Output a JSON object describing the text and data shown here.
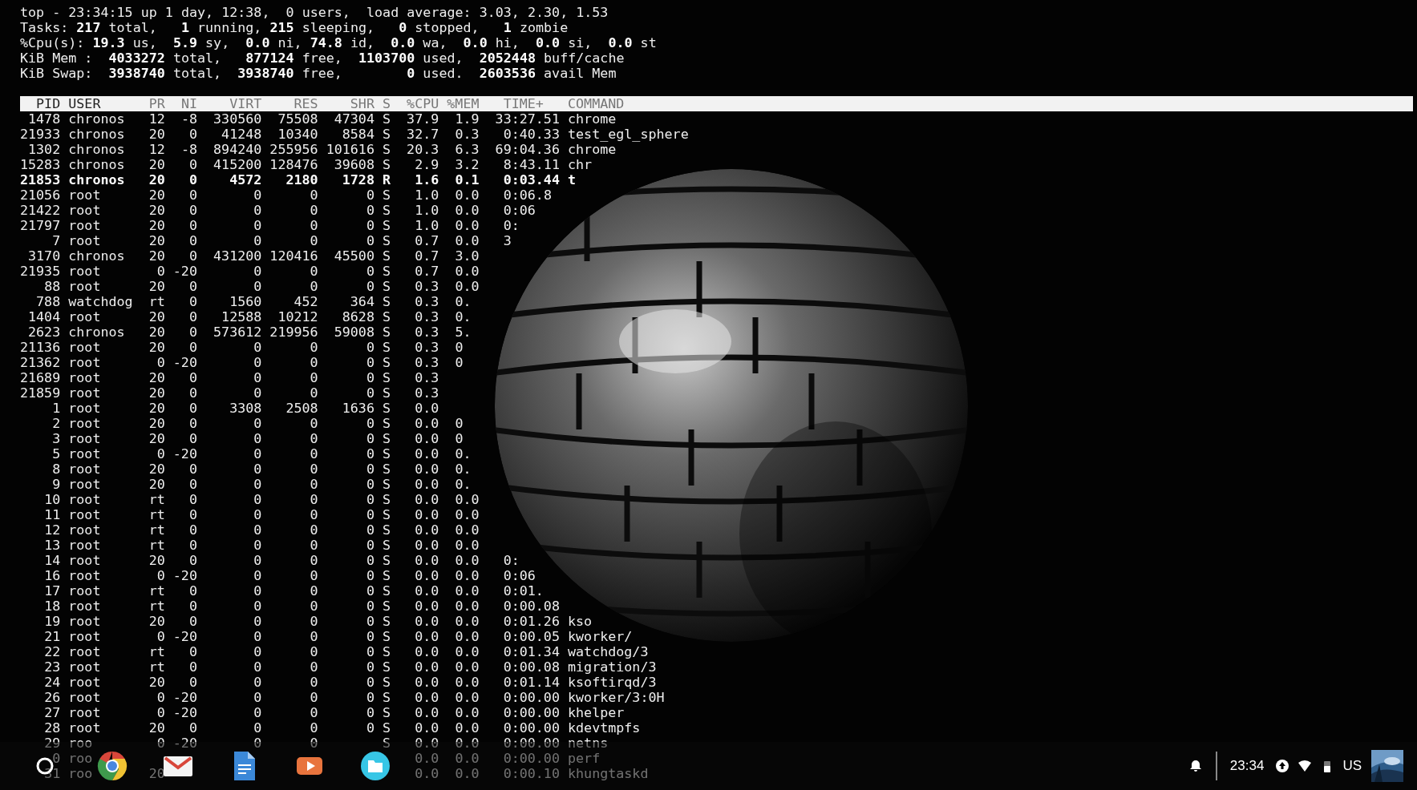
{
  "terminal": {
    "summary": [
      "top - 23:34:15 up 1 day, 12:38,  0 users,  load average: 3.03, 2.30, 1.53",
      "Tasks: **217** total,   **1** running, **215** sleeping,   **0** stopped,   **1** zombie",
      "%Cpu(s): **19.3** us,  **5.9** sy,  **0.0** ni, **74.8** id,  **0.0** wa,  **0.0** hi,  **0.0** si,  **0.0** st",
      "KiB Mem :  **4033272** total,   **877124** free,  **1103700** used,  **2052448** buff/cache",
      "KiB Swap:  **3938740** total,  **3938740** free,        **0** used.  **2603536** avail Mem"
    ],
    "columns": [
      "PID",
      "USER",
      "PR",
      "NI",
      "VIRT",
      "RES",
      "SHR",
      "S",
      "%CPU",
      "%MEM",
      "TIME+",
      "COMMAND"
    ],
    "rows": [
      {
        "bold": false,
        "cells": {
          "pid": "1478",
          "user": "chronos",
          "pr": "12",
          "ni": "-8",
          "virt": "330560",
          "res": "75508",
          "shr": "47304",
          "s": "S",
          "cpu": "37.9",
          "mem": "1.9",
          "time": "33:27.51",
          "command": "chrome"
        }
      },
      {
        "bold": false,
        "cells": {
          "pid": "21933",
          "user": "chronos",
          "pr": "20",
          "ni": "0",
          "virt": "41248",
          "res": "10340",
          "shr": "8584",
          "s": "S",
          "cpu": "32.7",
          "mem": "0.3",
          "time": "0:40.33",
          "command": "test_egl_sphere"
        }
      },
      {
        "bold": false,
        "cells": {
          "pid": "1302",
          "user": "chronos",
          "pr": "12",
          "ni": "-8",
          "virt": "894240",
          "res": "255956",
          "shr": "101616",
          "s": "S",
          "cpu": "20.3",
          "mem": "6.3",
          "time": "69:04.36",
          "command": "chrome"
        }
      },
      {
        "bold": false,
        "cells": {
          "pid": "15283",
          "user": "chronos",
          "pr": "20",
          "ni": "0",
          "virt": "415200",
          "res": "128476",
          "shr": "39608",
          "s": "S",
          "cpu": "2.9",
          "mem": "3.2",
          "time": "8:43.11",
          "command": "chr"
        }
      },
      {
        "bold": true,
        "cells": {
          "pid": "21853",
          "user": "chronos",
          "pr": "20",
          "ni": "0",
          "virt": "4572",
          "res": "2180",
          "shr": "1728",
          "s": "R",
          "cpu": "1.6",
          "mem": "0.1",
          "time": "0:03.44",
          "command": "t"
        }
      },
      {
        "bold": false,
        "cells": {
          "pid": "21056",
          "user": "root",
          "pr": "20",
          "ni": "0",
          "virt": "0",
          "res": "0",
          "shr": "0",
          "s": "S",
          "cpu": "1.0",
          "mem": "0.0",
          "time": "0:06.8"
        }
      },
      {
        "bold": false,
        "cells": {
          "pid": "21422",
          "user": "root",
          "pr": "20",
          "ni": "0",
          "virt": "0",
          "res": "0",
          "shr": "0",
          "s": "S",
          "cpu": "1.0",
          "mem": "0.0",
          "time": "0:06"
        }
      },
      {
        "bold": false,
        "cells": {
          "pid": "21797",
          "user": "root",
          "pr": "20",
          "ni": "0",
          "virt": "0",
          "res": "0",
          "shr": "0",
          "s": "S",
          "cpu": "1.0",
          "mem": "0.0",
          "time": "0:"
        }
      },
      {
        "bold": false,
        "cells": {
          "pid": "7",
          "user": "root",
          "pr": "20",
          "ni": "0",
          "virt": "0",
          "res": "0",
          "shr": "0",
          "s": "S",
          "cpu": "0.7",
          "mem": "0.0",
          "time": "3"
        }
      },
      {
        "bold": false,
        "cells": {
          "pid": "3170",
          "user": "chronos",
          "pr": "20",
          "ni": "0",
          "virt": "431200",
          "res": "120416",
          "shr": "45500",
          "s": "S",
          "cpu": "0.7",
          "mem": "3.0"
        }
      },
      {
        "bold": false,
        "cells": {
          "pid": "21935",
          "user": "root",
          "pr": "0",
          "ni": "-20",
          "virt": "0",
          "res": "0",
          "shr": "0",
          "s": "S",
          "cpu": "0.7",
          "mem": "0.0"
        }
      },
      {
        "bold": false,
        "cells": {
          "pid": "88",
          "user": "root",
          "pr": "20",
          "ni": "0",
          "virt": "0",
          "res": "0",
          "shr": "0",
          "s": "S",
          "cpu": "0.3",
          "mem": "0.0"
        }
      },
      {
        "bold": false,
        "cells": {
          "pid": "788",
          "user": "watchdog",
          "pr": "rt",
          "ni": "0",
          "virt": "1560",
          "res": "452",
          "shr": "364",
          "s": "S",
          "cpu": "0.3",
          "mem": "0."
        }
      },
      {
        "bold": false,
        "cells": {
          "pid": "1404",
          "user": "root",
          "pr": "20",
          "ni": "0",
          "virt": "12588",
          "res": "10212",
          "shr": "8628",
          "s": "S",
          "cpu": "0.3",
          "mem": "0."
        }
      },
      {
        "bold": false,
        "cells": {
          "pid": "2623",
          "user": "chronos",
          "pr": "20",
          "ni": "0",
          "virt": "573612",
          "res": "219956",
          "shr": "59008",
          "s": "S",
          "cpu": "0.3",
          "mem": "5."
        }
      },
      {
        "bold": false,
        "cells": {
          "pid": "21136",
          "user": "root",
          "pr": "20",
          "ni": "0",
          "virt": "0",
          "res": "0",
          "shr": "0",
          "s": "S",
          "cpu": "0.3",
          "mem": "0"
        }
      },
      {
        "bold": false,
        "cells": {
          "pid": "21362",
          "user": "root",
          "pr": "0",
          "ni": "-20",
          "virt": "0",
          "res": "0",
          "shr": "0",
          "s": "S",
          "cpu": "0.3",
          "mem": "0"
        }
      },
      {
        "bold": false,
        "cells": {
          "pid": "21689",
          "user": "root",
          "pr": "20",
          "ni": "0",
          "virt": "0",
          "res": "0",
          "shr": "0",
          "s": "S",
          "cpu": "0.3"
        }
      },
      {
        "bold": false,
        "cells": {
          "pid": "21859",
          "user": "root",
          "pr": "20",
          "ni": "0",
          "virt": "0",
          "res": "0",
          "shr": "0",
          "s": "S",
          "cpu": "0.3"
        }
      },
      {
        "bold": false,
        "cells": {
          "pid": "1",
          "user": "root",
          "pr": "20",
          "ni": "0",
          "virt": "3308",
          "res": "2508",
          "shr": "1636",
          "s": "S",
          "cpu": "0.0"
        }
      },
      {
        "bold": false,
        "cells": {
          "pid": "2",
          "user": "root",
          "pr": "20",
          "ni": "0",
          "virt": "0",
          "res": "0",
          "shr": "0",
          "s": "S",
          "cpu": "0.0",
          "mem": "0"
        }
      },
      {
        "bold": false,
        "cells": {
          "pid": "3",
          "user": "root",
          "pr": "20",
          "ni": "0",
          "virt": "0",
          "res": "0",
          "shr": "0",
          "s": "S",
          "cpu": "0.0",
          "mem": "0"
        }
      },
      {
        "bold": false,
        "cells": {
          "pid": "5",
          "user": "root",
          "pr": "0",
          "ni": "-20",
          "virt": "0",
          "res": "0",
          "shr": "0",
          "s": "S",
          "cpu": "0.0",
          "mem": "0."
        }
      },
      {
        "bold": false,
        "cells": {
          "pid": "8",
          "user": "root",
          "pr": "20",
          "ni": "0",
          "virt": "0",
          "res": "0",
          "shr": "0",
          "s": "S",
          "cpu": "0.0",
          "mem": "0."
        }
      },
      {
        "bold": false,
        "cells": {
          "pid": "9",
          "user": "root",
          "pr": "20",
          "ni": "0",
          "virt": "0",
          "res": "0",
          "shr": "0",
          "s": "S",
          "cpu": "0.0",
          "mem": "0."
        }
      },
      {
        "bold": false,
        "cells": {
          "pid": "10",
          "user": "root",
          "pr": "rt",
          "ni": "0",
          "virt": "0",
          "res": "0",
          "shr": "0",
          "s": "S",
          "cpu": "0.0",
          "mem": "0.0"
        }
      },
      {
        "bold": false,
        "cells": {
          "pid": "11",
          "user": "root",
          "pr": "rt",
          "ni": "0",
          "virt": "0",
          "res": "0",
          "shr": "0",
          "s": "S",
          "cpu": "0.0",
          "mem": "0.0"
        }
      },
      {
        "bold": false,
        "cells": {
          "pid": "12",
          "user": "root",
          "pr": "rt",
          "ni": "0",
          "virt": "0",
          "res": "0",
          "shr": "0",
          "s": "S",
          "cpu": "0.0",
          "mem": "0.0"
        }
      },
      {
        "bold": false,
        "cells": {
          "pid": "13",
          "user": "root",
          "pr": "rt",
          "ni": "0",
          "virt": "0",
          "res": "0",
          "shr": "0",
          "s": "S",
          "cpu": "0.0",
          "mem": "0.0"
        }
      },
      {
        "bold": false,
        "cells": {
          "pid": "14",
          "user": "root",
          "pr": "20",
          "ni": "0",
          "virt": "0",
          "res": "0",
          "shr": "0",
          "s": "S",
          "cpu": "0.0",
          "mem": "0.0",
          "time": "0:"
        }
      },
      {
        "bold": false,
        "cells": {
          "pid": "16",
          "user": "root",
          "pr": "0",
          "ni": "-20",
          "virt": "0",
          "res": "0",
          "shr": "0",
          "s": "S",
          "cpu": "0.0",
          "mem": "0.0",
          "time": "0:06"
        }
      },
      {
        "bold": false,
        "cells": {
          "pid": "17",
          "user": "root",
          "pr": "rt",
          "ni": "0",
          "virt": "0",
          "res": "0",
          "shr": "0",
          "s": "S",
          "cpu": "0.0",
          "mem": "0.0",
          "time": "0:01."
        }
      },
      {
        "bold": false,
        "cells": {
          "pid": "18",
          "user": "root",
          "pr": "rt",
          "ni": "0",
          "virt": "0",
          "res": "0",
          "shr": "0",
          "s": "S",
          "cpu": "0.0",
          "mem": "0.0",
          "time": "0:00.08"
        }
      },
      {
        "bold": false,
        "cells": {
          "pid": "19",
          "user": "root",
          "pr": "20",
          "ni": "0",
          "virt": "0",
          "res": "0",
          "shr": "0",
          "s": "S",
          "cpu": "0.0",
          "mem": "0.0",
          "time": "0:01.26",
          "command": "kso"
        }
      },
      {
        "bold": false,
        "cells": {
          "pid": "21",
          "user": "root",
          "pr": "0",
          "ni": "-20",
          "virt": "0",
          "res": "0",
          "shr": "0",
          "s": "S",
          "cpu": "0.0",
          "mem": "0.0",
          "time": "0:00.05",
          "command": "kworker/"
        }
      },
      {
        "bold": false,
        "cells": {
          "pid": "22",
          "user": "root",
          "pr": "rt",
          "ni": "0",
          "virt": "0",
          "res": "0",
          "shr": "0",
          "s": "S",
          "cpu": "0.0",
          "mem": "0.0",
          "time": "0:01.34",
          "command": "watchdog/3"
        }
      },
      {
        "bold": false,
        "cells": {
          "pid": "23",
          "user": "root",
          "pr": "rt",
          "ni": "0",
          "virt": "0",
          "res": "0",
          "shr": "0",
          "s": "S",
          "cpu": "0.0",
          "mem": "0.0",
          "time": "0:00.08",
          "command": "migration/3"
        }
      },
      {
        "bold": false,
        "cells": {
          "pid": "24",
          "user": "root",
          "pr": "20",
          "ni": "0",
          "virt": "0",
          "res": "0",
          "shr": "0",
          "s": "S",
          "cpu": "0.0",
          "mem": "0.0",
          "time": "0:01.14",
          "command": "ksoftirqd/3"
        }
      },
      {
        "bold": false,
        "cells": {
          "pid": "26",
          "user": "root",
          "pr": "0",
          "ni": "-20",
          "virt": "0",
          "res": "0",
          "shr": "0",
          "s": "S",
          "cpu": "0.0",
          "mem": "0.0",
          "time": "0:00.00",
          "command": "kworker/3:0H"
        }
      },
      {
        "bold": false,
        "cells": {
          "pid": "27",
          "user": "root",
          "pr": "0",
          "ni": "-20",
          "virt": "0",
          "res": "0",
          "shr": "0",
          "s": "S",
          "cpu": "0.0",
          "mem": "0.0",
          "time": "0:00.00",
          "command": "khelper"
        }
      },
      {
        "bold": false,
        "cells": {
          "pid": "28",
          "user": "root",
          "pr": "20",
          "ni": "0",
          "virt": "0",
          "res": "0",
          "shr": "0",
          "s": "S",
          "cpu": "0.0",
          "mem": "0.0",
          "time": "0:00.00",
          "command": "kdevtmpfs"
        }
      },
      {
        "bold": false,
        "cells": {
          "pid": "29",
          "user": "roo",
          "pr": "0",
          "ni": "-20",
          "virt": "0",
          "res": "0",
          "s": "S",
          "cpu": "0.0",
          "mem": "0.0",
          "time": "0:00.00",
          "command": "netns"
        }
      },
      {
        "bold": false,
        "cells": {
          "pid": "0",
          "user": "roo",
          "cpu": "0.0",
          "mem": "0.0",
          "time": "0:00.00",
          "command": "perf"
        }
      },
      {
        "bold": false,
        "cells": {
          "pid": "31",
          "user": "roo",
          "pr": "20",
          "cpu": "0.0",
          "mem": "0.0",
          "time": "0:00.10",
          "command": "khungtaskd"
        }
      }
    ]
  },
  "shelf": {
    "apps": [
      {
        "kind": "launcher"
      },
      {
        "kind": "browser"
      },
      {
        "kind": "mail"
      },
      {
        "kind": "docs"
      },
      {
        "kind": "video"
      },
      {
        "kind": "files"
      }
    ],
    "tray": {
      "time": "23:34",
      "input": "US"
    }
  }
}
